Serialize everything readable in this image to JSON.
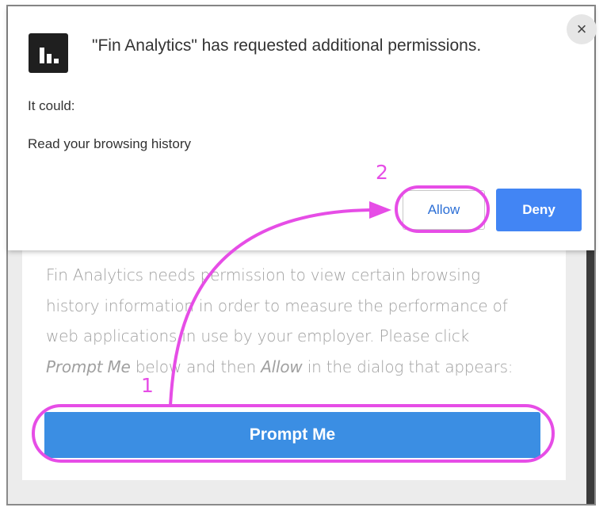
{
  "popup": {
    "title": "\"Fin Analytics\" has requested additional permissions.",
    "intro": "It could:",
    "permissions": [
      "Read your browsing history"
    ],
    "allow_label": "Allow",
    "deny_label": "Deny",
    "close_glyph": "×",
    "app_icon": "bar-chart-icon"
  },
  "page": {
    "text_lines": [
      {
        "parts": [
          {
            "t": "Fin Analytics needs permission to view certain browsing"
          }
        ]
      },
      {
        "parts": [
          {
            "t": "history information in order to measure the performance of"
          }
        ]
      },
      {
        "parts": [
          {
            "t": "web applications in use by your employer. Please click"
          }
        ]
      },
      {
        "parts": [
          {
            "t": "Prompt Me",
            "i": true
          },
          {
            "t": " below and then "
          },
          {
            "t": "Allow",
            "i": true
          },
          {
            "t": " in the dialog that appears:"
          }
        ]
      }
    ],
    "button_label": "Prompt Me"
  },
  "annotations": {
    "step1": "1",
    "step2": "2",
    "color": "#e64de6"
  }
}
